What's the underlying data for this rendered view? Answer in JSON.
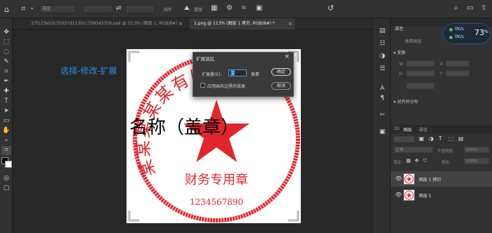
{
  "options_bar": {
    "mode_field": "选区",
    "blur_label": "消除",
    "mask_button": "蒙版"
  },
  "tabs": [
    {
      "label": "37f123e53c35037d1130cc799043309.psd @ 33.3% (图层 1, RGB/8#)",
      "close": "×"
    },
    {
      "label": "1.png @ 113% (图层 1 拷贝, RGB/8#) *",
      "close": "×"
    }
  ],
  "canvas": {
    "annotation": "选择-修改-扩展",
    "stamp_text_arc": "某某某某某有限公司",
    "stamp_text_middle": "名称（盖章）",
    "stamp_text_finance": "财务专用章",
    "stamp_number": "1234567890"
  },
  "dialog": {
    "title": "扩展选区",
    "close": "×",
    "amount_label": "扩展量(E):",
    "amount_value": "2",
    "unit": "像素",
    "checkbox_label": "应用画布边界的效果",
    "ok": "确定",
    "cancel": "取消"
  },
  "panel": {
    "properties_tab": "属性",
    "sub_label": "像素图层",
    "transform_header": "变换",
    "align_header": "对齐并分布",
    "w_label": "W",
    "h_label": "H",
    "x_label": "X",
    "y_label": "Y",
    "layers_tabs": [
      "3D",
      "图层",
      "通道"
    ],
    "blend_mode": "正常",
    "opacity_label": "不透明度:",
    "opacity_value": "100%",
    "lock_label": "锁定:",
    "fill_label": "填充:",
    "fill_value": "100%",
    "layers": [
      {
        "name": "图层 1 拷贝",
        "selected": true
      },
      {
        "name": "图层 1",
        "selected": false
      }
    ]
  },
  "network_badge": {
    "percent": "73",
    "percent_sign": "%",
    "up": "0K/s",
    "down": "0K/s"
  },
  "colors": {
    "accent_blue": "#2a8fe8",
    "stamp_red": "#e3262d",
    "foreground": "#000000",
    "background": "#ffffff"
  }
}
